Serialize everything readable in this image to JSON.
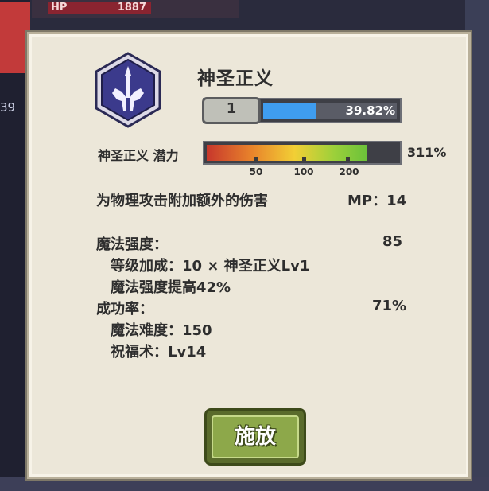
{
  "background": {
    "hp_label": "HP",
    "hp_value": "1887",
    "side_number": "39"
  },
  "skill": {
    "title": "神圣正义",
    "icon": "holy-justice-icon",
    "level": "1",
    "xp_percent_text": "39.82%",
    "xp_fraction": 0.3982
  },
  "potential": {
    "label": "神圣正义 潜力",
    "value": "311%",
    "fill_fraction": 0.84,
    "markers": [
      "50",
      "100",
      "200"
    ]
  },
  "description": {
    "text": "为物理攻击附加额外的伤害",
    "mp": "MP：14"
  },
  "stats": {
    "magic_power_label": "魔法强度：",
    "magic_power_value": "85",
    "level_bonus": "等级加成：10 × 神圣正义Lv1",
    "magic_increase": "魔法强度提高42%",
    "success_label": "成功率：",
    "success_value": "71%",
    "difficulty": "魔法难度：150",
    "blessing": "祝福术：Lv14"
  },
  "actions": {
    "cast_label": "施放"
  },
  "colors": {
    "dialog_bg": "#ece7d9",
    "xp_fill": "#3f9df0",
    "cast_button": "#8da84a",
    "icon_bg": "#3b3a8c"
  }
}
